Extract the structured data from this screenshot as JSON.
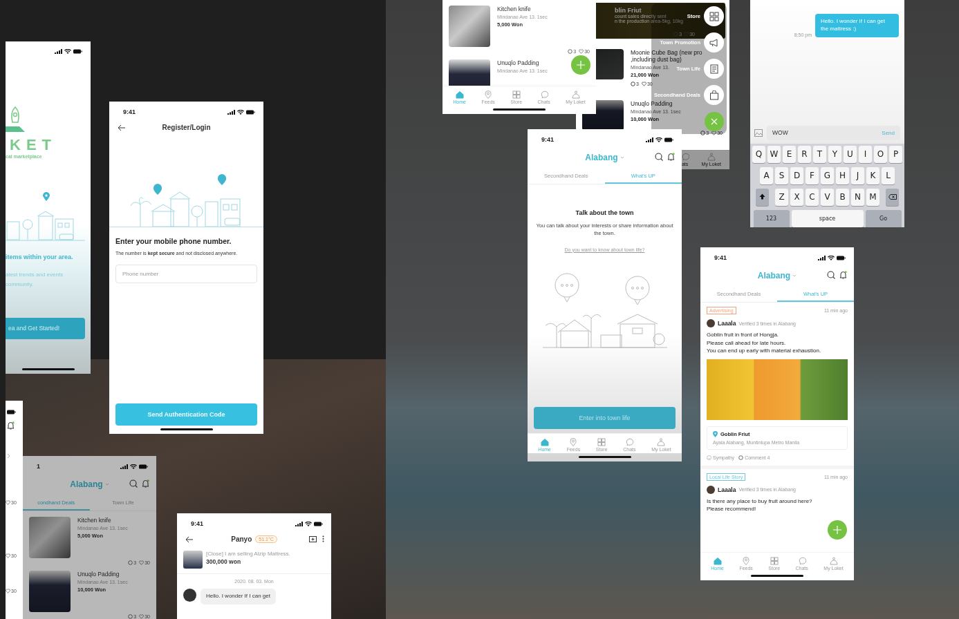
{
  "splash": {
    "brand": "KET",
    "tagline": "cal marketplace",
    "headline": "items within your area.",
    "subtext": "atest trends and events\ncommunity.",
    "button": "ea and Get Started!"
  },
  "login": {
    "time": "9:41",
    "title": "Register/Login",
    "heading": "Enter your mobile phone number.",
    "note": "The number is **kept secure** and not disclosed anywhere.",
    "phone_field": {
      "placeholder": "Phone number"
    },
    "button": "Send Authentication Code"
  },
  "edge_phone": {
    "likes": [
      "30",
      "30",
      "30"
    ]
  },
  "deals_phone": {
    "time": "1",
    "location": "Alabang",
    "tabs": [
      {
        "label": "condhand Deals",
        "selected": true
      },
      {
        "label": "Town Life",
        "selected": false
      }
    ],
    "items": [
      {
        "title": "Kitchen knife",
        "meta": "Mindanao Ave 13. 1sec",
        "price": "5,000 Won",
        "comments": "3",
        "likes": "30"
      },
      {
        "title": "Unuqlo Padding",
        "meta": "Mindanao Ave 13. 1sec",
        "price": "10,000 Won",
        "comments": "3",
        "likes": "30"
      }
    ]
  },
  "chat_phone": {
    "time": "9:41",
    "partner": "Panyo",
    "temperature": "51.1°C",
    "listing": {
      "title": "[Close] I am selling Alzip Mattress.",
      "price": "300,000 won"
    },
    "date": "2020. 08. 03. Mon",
    "messages": [
      {
        "text": "Hello. I wonder If I can get"
      }
    ]
  },
  "home_phone": {
    "items": [
      {
        "title": "Kitchen knife",
        "meta": "Mindanao Ave 13. 1sec",
        "price": "5,000 Won",
        "comments": "3",
        "likes": "30"
      },
      {
        "title": "Unuqlo Padding",
        "meta": "Mindanao Ave 13. 1sec"
      }
    ],
    "nav": [
      {
        "label": "Home",
        "kind": "home",
        "selected": true
      },
      {
        "label": "Feeds",
        "kind": "pin",
        "selected": false
      },
      {
        "label": "Store",
        "kind": "grid",
        "selected": false
      },
      {
        "label": "Chats",
        "kind": "chat",
        "selected": false
      },
      {
        "label": "My Loket",
        "kind": "person",
        "selected": false
      }
    ]
  },
  "menu_phone": {
    "banner": {
      "title": "blin Friut",
      "lines": [
        "count sales directly sent",
        "n the production area-5kg, 10kg"
      ],
      "comments": "3",
      "likes": "30"
    },
    "items": [
      {
        "title": "Moonie Cube Bag (new pro\n,including dust bag)",
        "meta": "Mindanao Ave 13.",
        "price": "21,000 Won",
        "comments": "3",
        "likes": "30"
      },
      {
        "title": "Unuqlo Padding",
        "meta": "Mindanao Ave 13. 1sec",
        "price": "10,000 Won",
        "comments": "3",
        "likes": "30"
      }
    ],
    "nav": [
      {
        "label": "ats",
        "kind": "chat",
        "selected": false
      },
      {
        "label": "My Loket",
        "kind": "person",
        "selected": false
      }
    ],
    "menu": [
      {
        "label": "Store",
        "kind": "grid"
      },
      {
        "label": "Town Promotion",
        "kind": "megaphone"
      },
      {
        "label": "Town Life",
        "kind": "document"
      },
      {
        "label": "Secondhand Deals",
        "kind": "bag"
      }
    ]
  },
  "town_phone": {
    "time": "9:41",
    "location": "Alabang",
    "tabs": [
      {
        "label": "Secondhand Deals",
        "selected": false
      },
      {
        "label": "What's UP",
        "selected": true
      }
    ],
    "title": "Talk about the town",
    "text": "You can talk about your interests or share information about the town.",
    "link": "Do you want to know about town life?",
    "button": "Enter into town life",
    "nav": [
      {
        "label": "Home",
        "kind": "home",
        "selected": true
      },
      {
        "label": "Feeds",
        "kind": "pin",
        "selected": false
      },
      {
        "label": "Store",
        "kind": "grid",
        "selected": false
      },
      {
        "label": "Chats",
        "kind": "chat",
        "selected": false
      },
      {
        "label": "My Loket",
        "kind": "person",
        "selected": false
      }
    ]
  },
  "keyboard_phone": {
    "message": {
      "text": "Hello. I wonder If I can get the mattress :)",
      "time": "8:50 pm"
    },
    "input": {
      "value": "WOW"
    },
    "send": "Send",
    "keys": [
      [
        "Q",
        "W",
        "E",
        "R",
        "T",
        "Y",
        "U",
        "I",
        "O",
        "P"
      ],
      [
        "A",
        "S",
        "D",
        "F",
        "G",
        "H",
        "J",
        "K",
        "L"
      ],
      [
        "Z",
        "X",
        "C",
        "V",
        "B",
        "N",
        "M"
      ]
    ],
    "bottom_keys": [
      "123",
      "space",
      "Go"
    ]
  },
  "feed_phone": {
    "time": "9:41",
    "location": "Alabang",
    "tabs": [
      {
        "label": "Secondhand Deals",
        "selected": false
      },
      {
        "label": "What's UP",
        "selected": true
      }
    ],
    "posts": [
      {
        "tag": "Advertising",
        "color": "#f4a27a",
        "time": "11 min ago",
        "author": "Laaala",
        "verified": "Verified 3 times in Alabang",
        "text": "Goblin fruit in front of Hongja.\nPlease call ahead for late hours.\nYou can end up early with material exhaustion.",
        "photo": true,
        "place": {
          "name": "Goblin Friut",
          "address": "Ayala Alabang, Muntinlupa Metro Manila"
        },
        "actions": [
          "Sympathy",
          "Comment 4"
        ]
      },
      {
        "tag": "Local Life Story",
        "color": "#6cc6df",
        "time": "11 min ago",
        "author": "Laaala",
        "verified": "Verified 3 times in Alabang",
        "text": "Is there any place to buy fruit around here?\nPlease recommend!",
        "photo": false
      }
    ],
    "nav": [
      {
        "label": "Home",
        "kind": "home",
        "selected": true
      },
      {
        "label": "Feeds",
        "kind": "pin",
        "selected": false
      },
      {
        "label": "Store",
        "kind": "grid",
        "selected": false
      },
      {
        "label": "Chats",
        "kind": "chat",
        "selected": false
      },
      {
        "label": "My Loket",
        "kind": "person",
        "selected": false
      }
    ]
  }
}
